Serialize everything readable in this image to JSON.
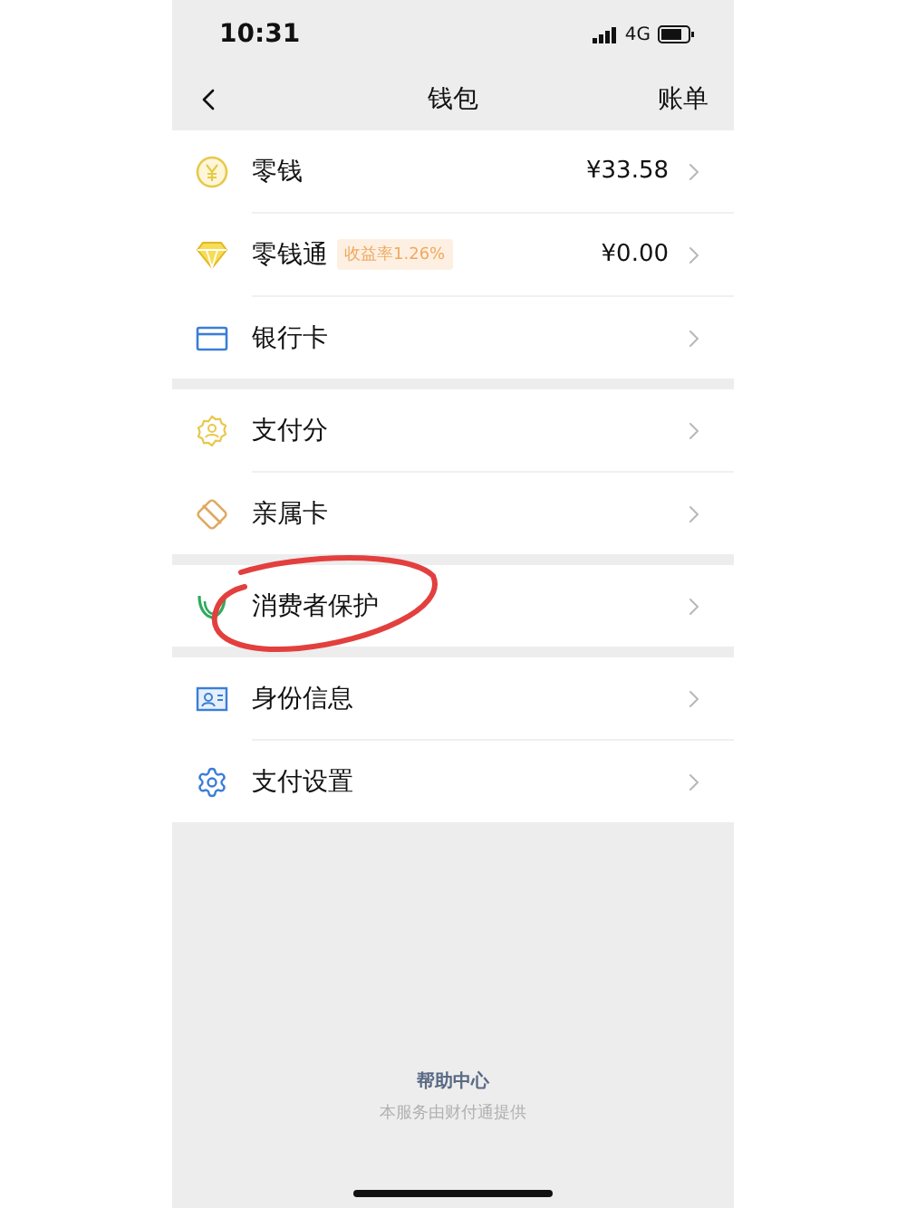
{
  "status_bar": {
    "time": "10:31",
    "network": "4G"
  },
  "nav": {
    "title": "钱包",
    "action": "账单"
  },
  "groups": [
    {
      "items": [
        {
          "label": "零钱",
          "value": "¥33.58",
          "circled": false
        },
        {
          "label": "零钱通",
          "badge": "收益率1.26%",
          "value": "¥0.00",
          "circled": false
        },
        {
          "label": "银行卡",
          "circled": false
        }
      ]
    },
    {
      "items": [
        {
          "label": "支付分",
          "circled": false
        },
        {
          "label": "亲属卡",
          "circled": false
        }
      ]
    },
    {
      "items": [
        {
          "label": "消费者保护",
          "circled": true
        }
      ]
    },
    {
      "items": [
        {
          "label": "身份信息",
          "circled": false
        },
        {
          "label": "支付设置",
          "circled": false
        }
      ]
    }
  ],
  "footer": {
    "link": "帮助中心",
    "note": "本服务由财付通提供"
  }
}
